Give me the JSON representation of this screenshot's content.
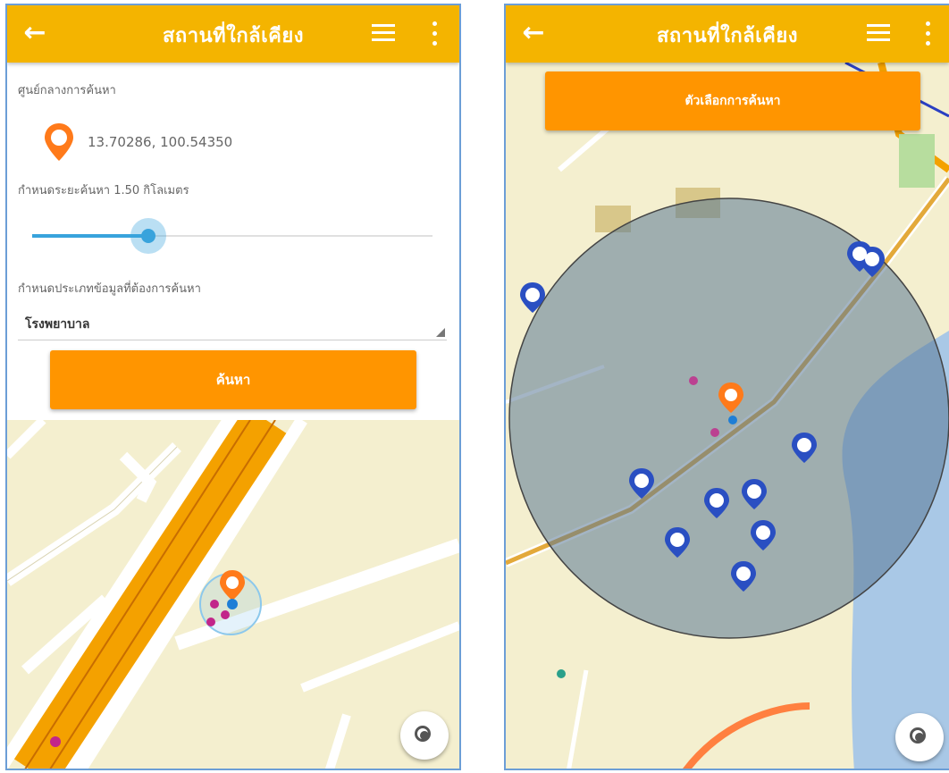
{
  "left": {
    "appbar": {
      "title": "สถานที่ใกล้เคียง"
    },
    "form": {
      "center_label": "ศูนย์กลางการค้นหา",
      "coordinates": "13.70286, 100.54350",
      "radius_label": "กำหนดระยะค้นหา 1.50 กิโลเมตร",
      "type_label": "กำหนดประเภทข้อมูลที่ต้องการค้นหา",
      "type_value": "โรงพยาบาล",
      "search_button": "ค้นหา"
    },
    "slider_fraction": 0.3
  },
  "right": {
    "appbar": {
      "title": "สถานที่ใกล้เคียง"
    },
    "options_button": "ตัวเลือกการค้นหา"
  },
  "colors": {
    "appbar": "#f4b400",
    "button": "#ff9500",
    "slider": "#38a3dc",
    "pin_orange": "#ff7a1a",
    "pin_blue": "#2a4fc2",
    "pin_magenta": "#c2268a"
  }
}
